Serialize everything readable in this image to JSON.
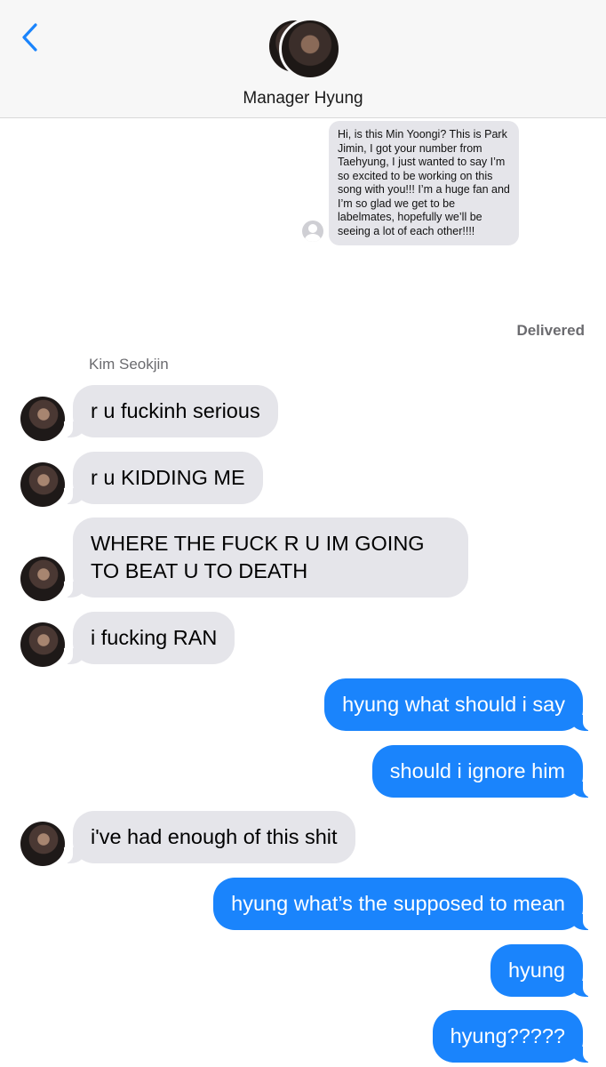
{
  "header": {
    "back_icon": "chevron-left-icon",
    "contact_name": "Manager Hyung"
  },
  "embedded_message": {
    "text": "Hi, is this Min Yoongi? This is Park Jimin, I got your number from Taehyung, I just wanted to say I’m so excited to be working on this song with you!!! I’m a huge fan and I’m so glad we get to be labelmates, hopefully we’ll be seeing a lot of each other!!!!"
  },
  "status": {
    "delivered": "Delivered"
  },
  "sender_name": "Kim Seokjin",
  "messages": [
    {
      "dir": "in",
      "text": "r u fuckinh serious"
    },
    {
      "dir": "in",
      "text": "r u KIDDING ME"
    },
    {
      "dir": "in",
      "text": "WHERE THE FUCK R U IM GOING TO BEAT U TO DEATH"
    },
    {
      "dir": "in",
      "text": "i fucking RAN"
    },
    {
      "dir": "out",
      "text": "hyung what should i say"
    },
    {
      "dir": "out",
      "text": "should i ignore him"
    },
    {
      "dir": "in",
      "text": "i've had enough of this shit"
    },
    {
      "dir": "out",
      "text": "hyung what’s the supposed to mean"
    },
    {
      "dir": "out",
      "text": "hyung"
    },
    {
      "dir": "out",
      "text": "hyung?????"
    }
  ],
  "colors": {
    "incoming_bubble": "#e5e5ea",
    "outgoing_bubble": "#1a84fc",
    "accent": "#1a84fc"
  }
}
